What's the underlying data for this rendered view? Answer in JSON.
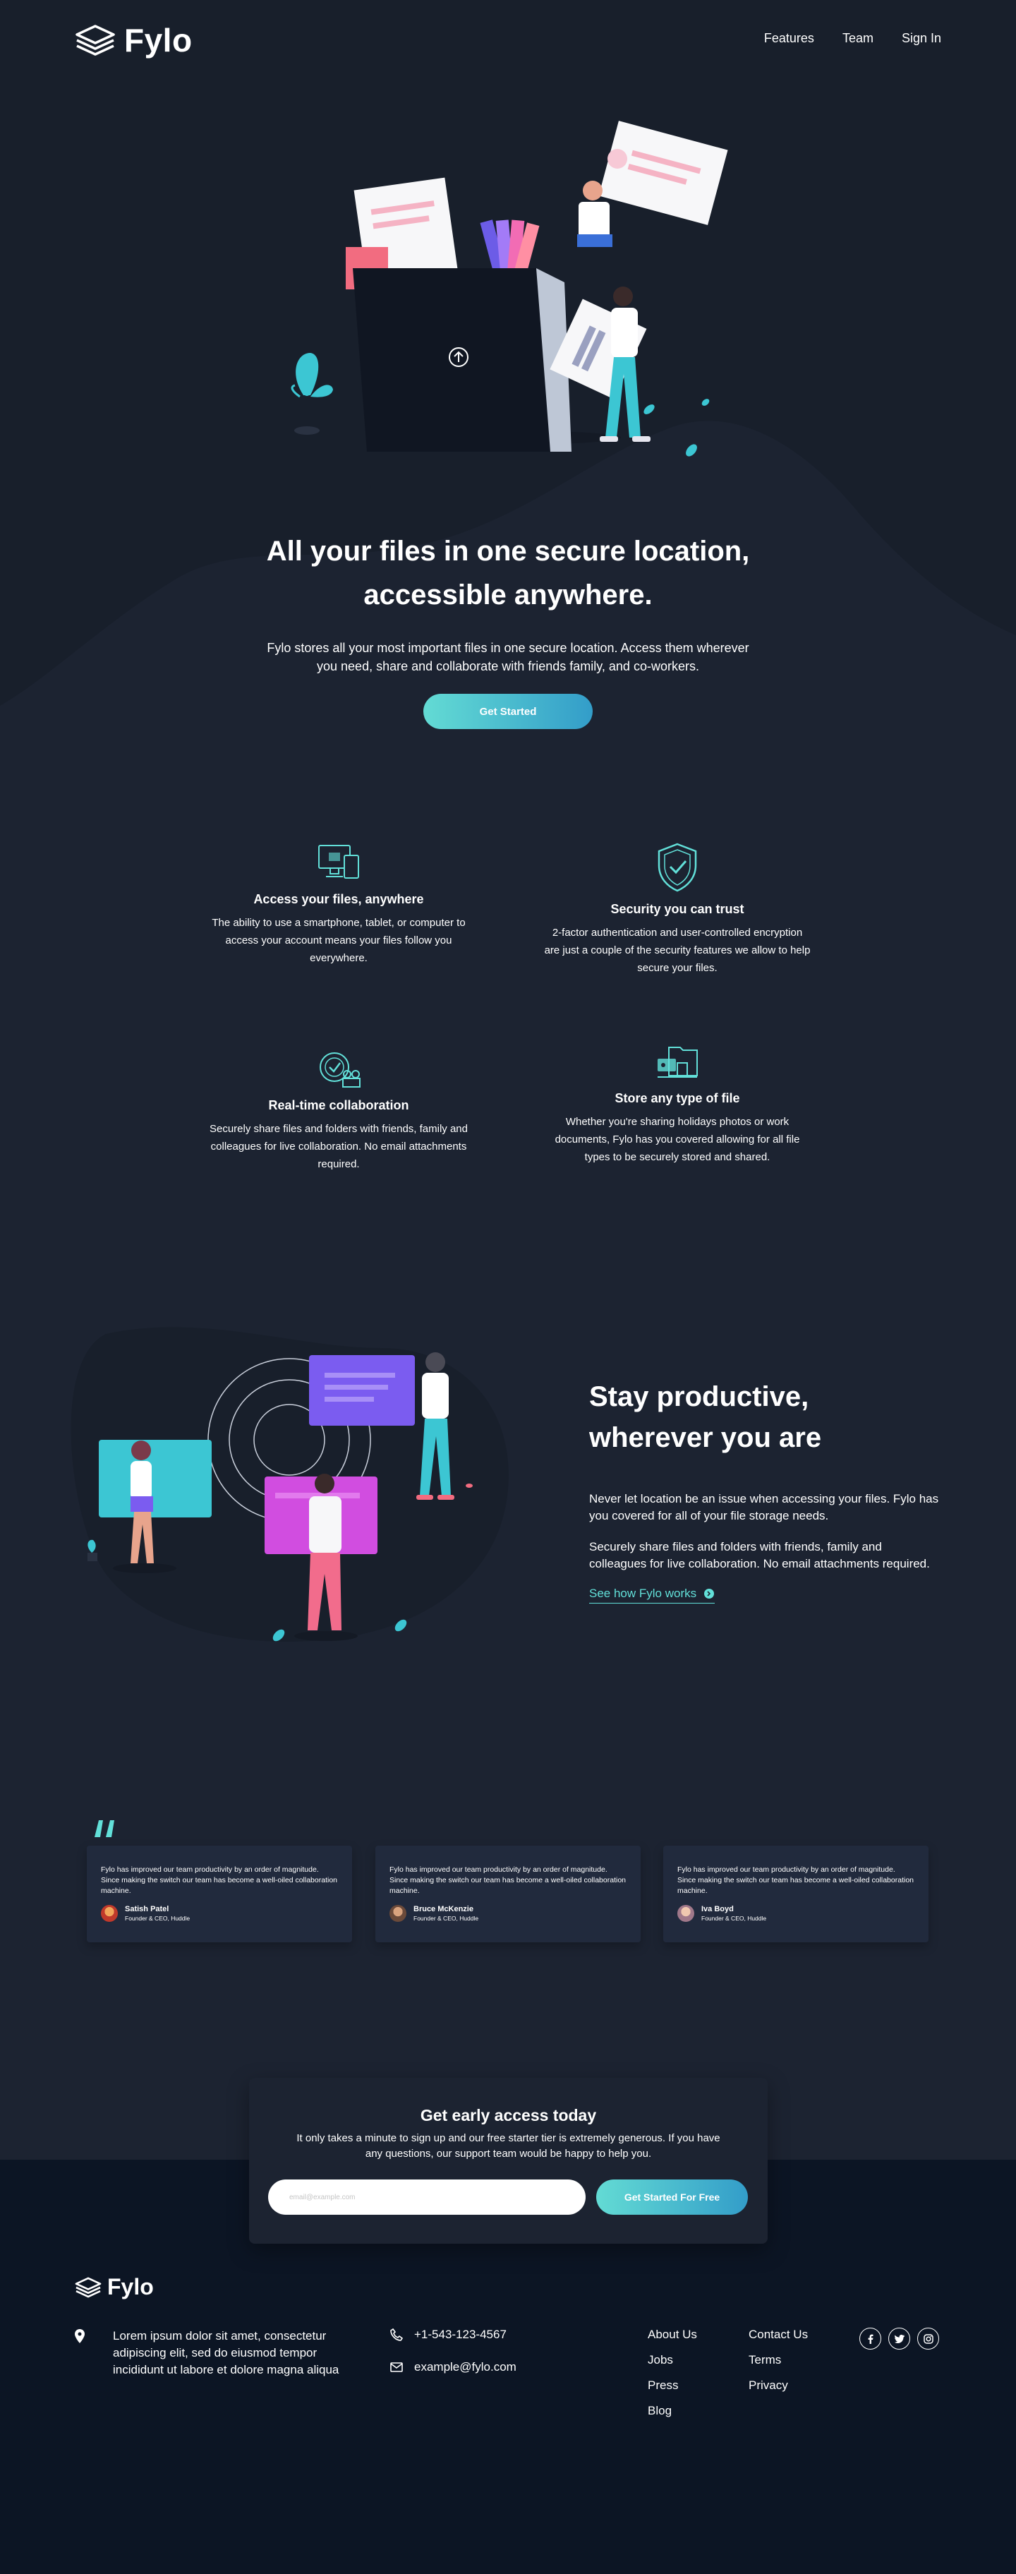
{
  "header": {
    "logo_text": "Fylo",
    "nav": [
      "Features",
      "Team",
      "Sign In"
    ]
  },
  "hero": {
    "title_line1": "All your files in one secure location,",
    "title_line2": "accessible anywhere.",
    "description": "Fylo stores all your most important files in one secure location. Access them wherever you need, share and collaborate with friends family, and co-workers.",
    "cta_label": "Get Started"
  },
  "features": [
    {
      "icon": "devices-icon",
      "title": "Access your files, anywhere",
      "text": "The ability to use a smartphone, tablet, or computer to access your account means your files follow you everywhere."
    },
    {
      "icon": "shield-check-icon",
      "title": "Security you can trust",
      "text": "2-factor authentication and user-controlled encryption are just a couple of the security features we allow to help secure your files."
    },
    {
      "icon": "collaboration-icon",
      "title": "Real-time collaboration",
      "text": "Securely share files and folders with friends, family and colleagues for live collaboration. No email attachments required."
    },
    {
      "icon": "file-types-icon",
      "title": "Store any type of file",
      "text": "Whether you're sharing holidays photos or work documents, Fylo has you covered allowing for all file types to be securely stored and shared."
    }
  ],
  "productive": {
    "title_line1": "Stay productive,",
    "title_line2": "wherever you are",
    "para1": "Never let location be an issue when accessing your files. Fylo has you covered for all of your file storage needs.",
    "para2": "Securely share files and folders with friends, family and colleagues for live collaboration. No email attachments required.",
    "link_label": "See how Fylo works"
  },
  "testimonials": [
    {
      "text": "Fylo has improved our team productivity by an order of magnitude. Since making the switch our team has become a well-oiled collaboration machine.",
      "name": "Satish Patel",
      "role": "Founder & CEO, Huddle"
    },
    {
      "text": "Fylo has improved our team productivity by an order of magnitude. Since making the switch our team has become a well-oiled collaboration machine.",
      "name": "Bruce McKenzie",
      "role": "Founder & CEO, Huddle"
    },
    {
      "text": "Fylo has improved our team productivity by an order of magnitude. Since making the switch our team has become a well-oiled collaboration machine.",
      "name": "Iva Boyd",
      "role": "Founder & CEO, Huddle"
    }
  ],
  "signup": {
    "title": "Get early access today",
    "description": "It only takes a minute to sign up and our free starter tier is extremely generous. If you have any questions, our support team would be happy to help you.",
    "email_placeholder": "email@example.com",
    "button_label": "Get Started For Free"
  },
  "footer": {
    "logo_text": "Fylo",
    "address": "Lorem ipsum dolor sit amet, consectetur adipiscing elit, sed do eiusmod tempor incididunt ut labore et dolore magna aliqua",
    "phone": "+1-543-123-4567",
    "email": "example@fylo.com",
    "links_col1": [
      "About Us",
      "Jobs",
      "Press",
      "Blog"
    ],
    "links_col2": [
      "Contact Us",
      "Terms",
      "Privacy"
    ],
    "socials": [
      "facebook-icon",
      "twitter-icon",
      "instagram-icon"
    ]
  },
  "colors": {
    "background": "#1c2331",
    "footer_background": "#0c1524",
    "card_background": "#212a3d",
    "accent_cyan": "#62e0d9",
    "accent_blue": "#339dc9"
  }
}
